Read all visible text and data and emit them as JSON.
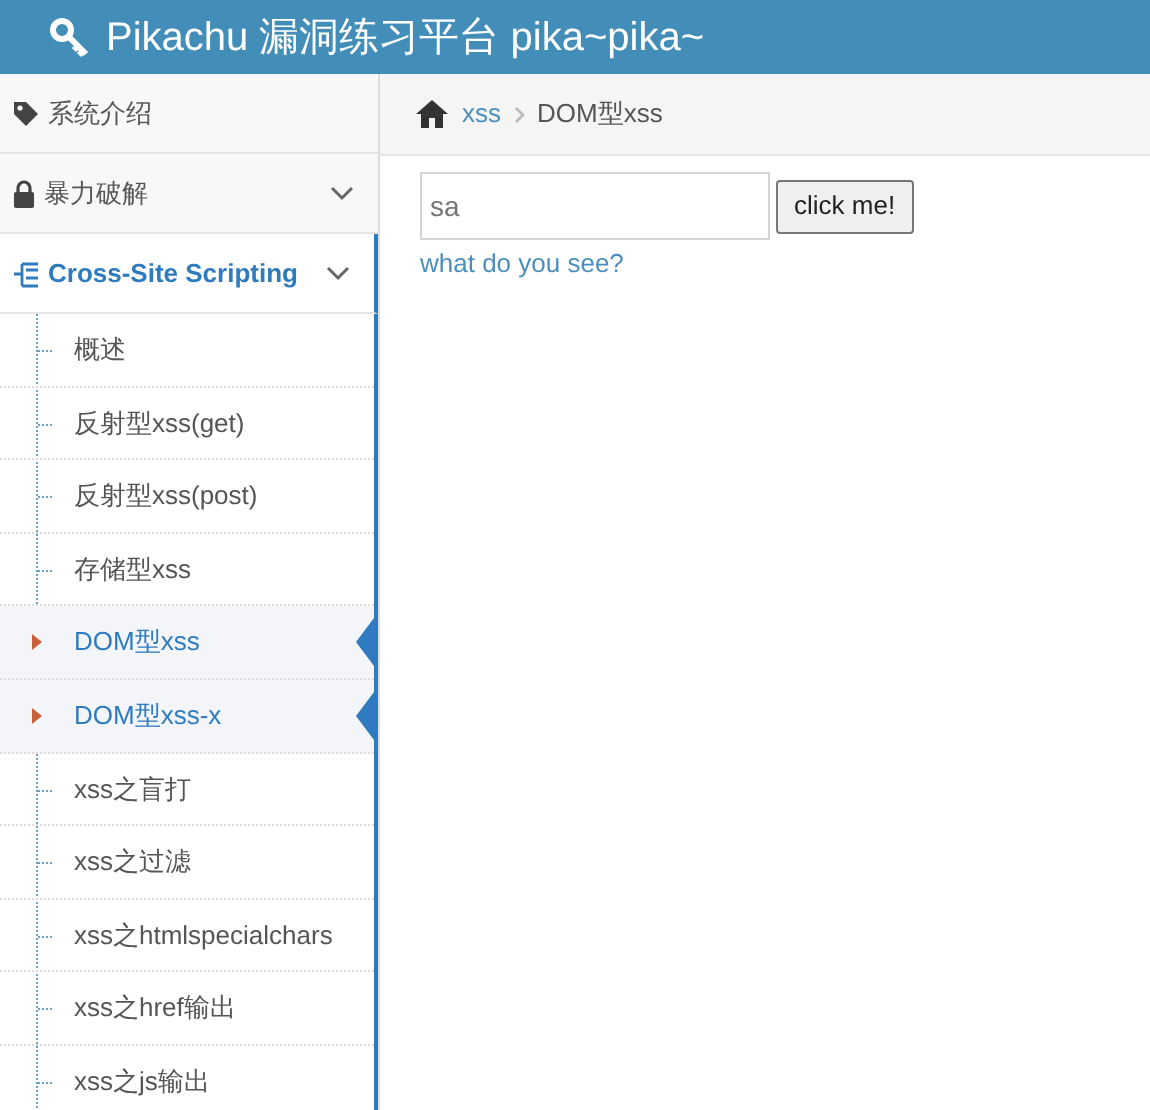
{
  "header": {
    "title": "Pikachu 漏洞练习平台 pika~pika~"
  },
  "sidebar": {
    "items": [
      {
        "kind": "link",
        "label": "系统介绍"
      },
      {
        "kind": "group",
        "label": "暴力破解",
        "expanded": false
      },
      {
        "kind": "group",
        "label": "Cross-Site Scripting",
        "expanded": true,
        "children": [
          {
            "label": "概述",
            "selected": false
          },
          {
            "label": "反射型xss(get)",
            "selected": false
          },
          {
            "label": "反射型xss(post)",
            "selected": false
          },
          {
            "label": "存储型xss",
            "selected": false
          },
          {
            "label": "DOM型xss",
            "selected": true
          },
          {
            "label": "DOM型xss-x",
            "selected": true
          },
          {
            "label": "xss之盲打",
            "selected": false
          },
          {
            "label": "xss之过滤",
            "selected": false
          },
          {
            "label": "xss之htmlspecialchars",
            "selected": false
          },
          {
            "label": "xss之href输出",
            "selected": false
          },
          {
            "label": "xss之js输出",
            "selected": false
          }
        ]
      }
    ]
  },
  "breadcrumb": [
    "xss",
    "DOM型xss"
  ],
  "form": {
    "input_value": "sa",
    "button": "click me!",
    "link": "what do you see?"
  }
}
